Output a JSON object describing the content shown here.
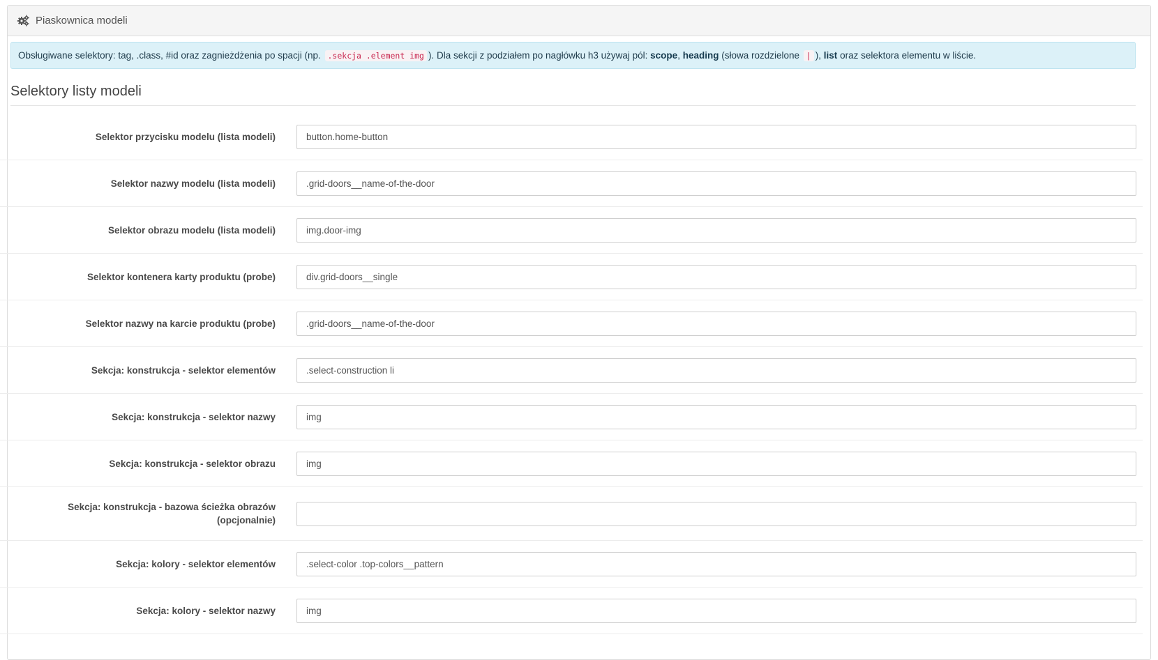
{
  "panel": {
    "title": "Piaskownica modeli",
    "icon": "gears-icon"
  },
  "alert": {
    "text_1": "Obsługiwane selektory: tag, .class, #id oraz zagnieżdżenia po spacji (np.",
    "code_1": ".sekcja .element img",
    "text_2": "). Dla sekcji z podziałem po nagłówku h3 używaj pól:",
    "bold_scope": "scope",
    "comma": ",",
    "bold_heading": "heading",
    "text_3": "(słowa rozdzielone",
    "code_2": "|",
    "text_4": "),",
    "bold_list": "list",
    "text_5": "oraz selektora elementu w liście."
  },
  "section": {
    "title": "Selektory listy modeli"
  },
  "fields": [
    {
      "label": "Selektor przycisku modelu (lista modeli)",
      "value": "button.home-button"
    },
    {
      "label": "Selektor nazwy modelu (lista modeli)",
      "value": ".grid-doors__name-of-the-door"
    },
    {
      "label": "Selektor obrazu modelu (lista modeli)",
      "value": "img.door-img"
    },
    {
      "label": "Selektor kontenera karty produktu (probe)",
      "value": "div.grid-doors__single"
    },
    {
      "label": "Selektor nazwy na karcie produktu (probe)",
      "value": ".grid-doors__name-of-the-door"
    },
    {
      "label": "Sekcja: konstrukcja - selektor elementów",
      "value": ".select-construction li"
    },
    {
      "label": "Sekcja: konstrukcja - selektor nazwy",
      "value": "img"
    },
    {
      "label": "Sekcja: konstrukcja - selektor obrazu",
      "value": "img"
    },
    {
      "label": "Sekcja: konstrukcja - bazowa ścieżka obrazów (opcjonalnie)",
      "value": ""
    },
    {
      "label": "Sekcja: kolory - selektor elementów",
      "value": ".select-color .top-colors__pattern"
    },
    {
      "label": "Sekcja: kolory - selektor nazwy",
      "value": "img"
    }
  ]
}
